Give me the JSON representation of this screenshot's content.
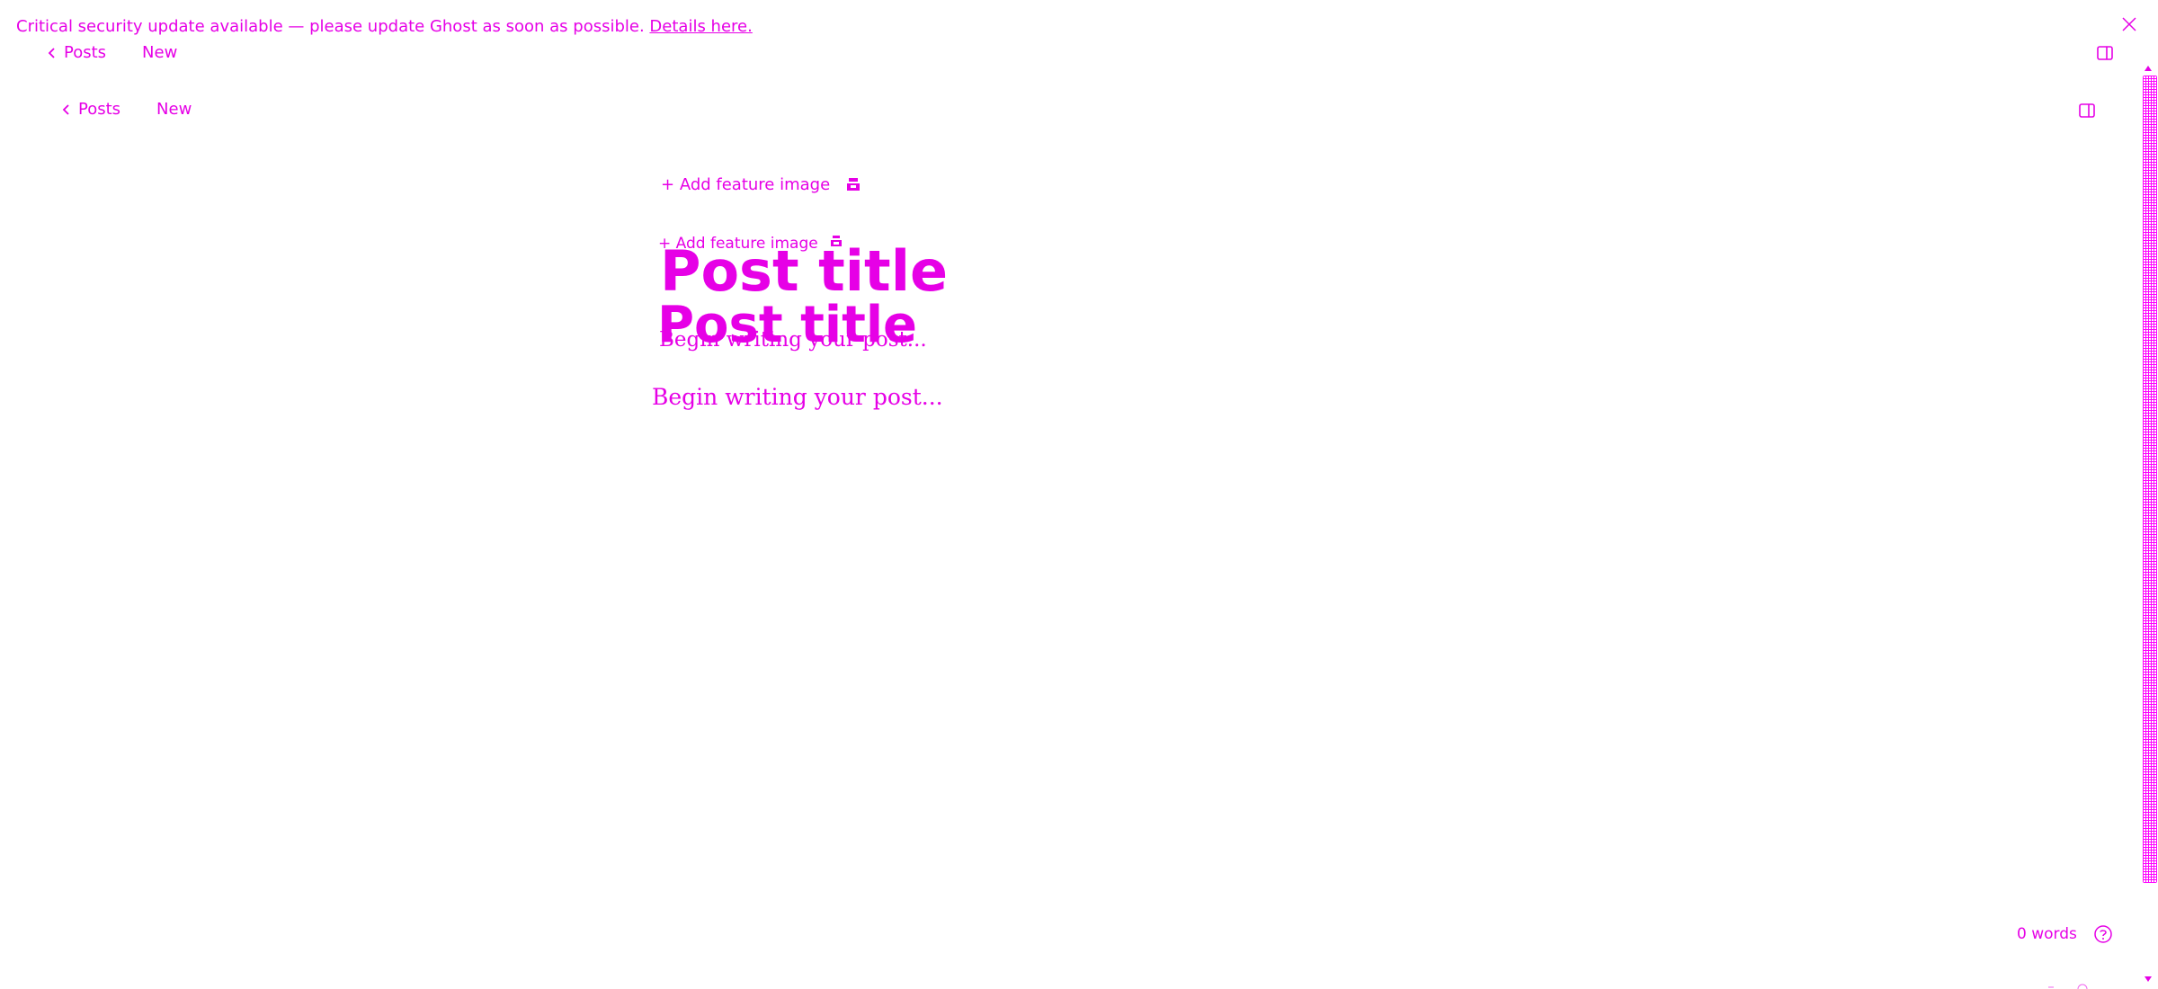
{
  "banner": {
    "message": "Critical security update available — please update Ghost as soon as possible.",
    "link_label": "Details here."
  },
  "header": {
    "back_label": "Posts",
    "status": "New"
  },
  "editor": {
    "feature_image_label": "Add feature image",
    "title_placeholder": "Post title",
    "body_placeholder": "Begin writing your post..."
  },
  "footer": {
    "word_count": "0 words"
  },
  "icons": {
    "close": "close-icon",
    "back": "chevron-left-icon",
    "toggle": "layout-toggle-icon",
    "image": "image-icon",
    "help": "question-icon"
  },
  "colors": {
    "accent": "#e600e6",
    "background": "#ffffff"
  }
}
